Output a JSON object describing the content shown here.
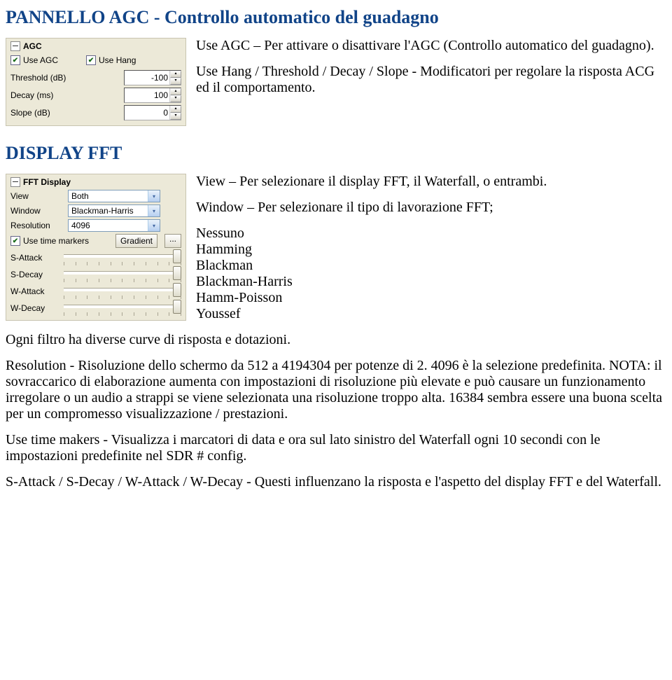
{
  "titles": {
    "agc": "PANNELLO AGC - Controllo automatico del guadagno",
    "fft": "DISPLAY FFT"
  },
  "agc_panel": {
    "header": "AGC",
    "use_agc_label": "Use AGC",
    "use_hang_label": "Use Hang",
    "rows": {
      "threshold": {
        "label": "Threshold (dB)",
        "value": "-100"
      },
      "decay": {
        "label": "Decay (ms)",
        "value": "100"
      },
      "slope": {
        "label": "Slope (dB)",
        "value": "0"
      }
    },
    "p1": "Use AGC – Per attivare o disattivare l'AGC (Controllo automatico del guadagno).",
    "p2": "Use Hang / Threshold / Decay / Slope - Modificatori per regolare la risposta ACG ed il comportamento."
  },
  "fft_panel": {
    "header": "FFT Display",
    "rows": {
      "view": {
        "label": "View",
        "value": "Both"
      },
      "window": {
        "label": "Window",
        "value": "Blackman-Harris"
      },
      "resolution": {
        "label": "Resolution",
        "value": "4096"
      }
    },
    "time_markers_label": "Use time markers",
    "gradient_label": "Gradient",
    "dots": "...",
    "sliders": {
      "sattack": "S-Attack",
      "sdecay": "S-Decay",
      "wattack": "W-Attack",
      "wdecay": "W-Decay"
    },
    "p_view": "View – Per selezionare il display FFT, il Waterfall, o entrambi.",
    "p_window": "Window – Per selezionare il tipo di lavorazione FFT;",
    "win_none": "Nessuno",
    "win_hamming": "Hamming",
    "win_blackman": "Blackman",
    "win_bh": "Blackman-Harris",
    "win_hp": "Hamm-Poisson",
    "win_y": "Youssef",
    "p_filter": "Ogni filtro ha diverse curve di risposta e dotazioni.",
    "p_resolution": "Resolution - Risoluzione dello schermo da 512 a 4194304 per potenze di 2. 4096 è la selezione predefinita. NOTA: il sovraccarico di elaborazione aumenta con impostazioni di risoluzione più elevate e può causare un funzionamento irregolare o un audio a strappi se viene selezionata una risoluzione troppo alta. 16384 sembra essere una buona scelta per un compromesso visualizzazione / prestazioni.",
    "p_time": "Use time makers - Visualizza i marcatori di data e ora sul lato sinistro del Waterfall ogni 10 secondi con le impostazioni predefinite nel SDR # config.",
    "p_sliders": "S-Attack / S-Decay / W-Attack / W-Decay - Questi influenzano la risposta e l'aspetto del display FFT e del Waterfall."
  }
}
